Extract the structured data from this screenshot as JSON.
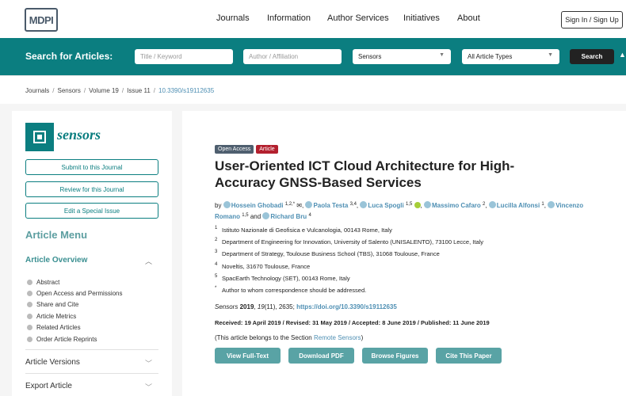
{
  "brand": {
    "logo_text": "MDPI"
  },
  "topnav": {
    "items": [
      "Journals",
      "Information",
      "Author Services",
      "Initiatives",
      "About"
    ],
    "signin": "Sign In / Sign Up"
  },
  "search": {
    "title": "Search for Articles:",
    "keyword_placeholder": "Title / Keyword",
    "author_placeholder": "Author / Affiliation",
    "journal_select": "Sensors",
    "type_select": "All Article Types",
    "button": "Search"
  },
  "breadcrumb": [
    "Journals",
    "Sensors",
    "Volume 19",
    "Issue 11",
    "10.3390/s19112635"
  ],
  "sidebar": {
    "journal_name": "sensors",
    "buttons": [
      "Submit to this Journal",
      "Review for this Journal",
      "Edit a Special Issue"
    ],
    "menu_title": "Article Menu",
    "overview_title": "Article Overview",
    "overview_items": [
      "Abstract",
      "Open Access and Permissions",
      "Share and Cite",
      "Article Metrics",
      "Related Articles",
      "Order Article Reprints"
    ],
    "sections": [
      "Article Versions",
      "Export Article"
    ]
  },
  "article": {
    "badges": [
      "Open Access",
      "Article"
    ],
    "title": "User-Oriented ICT Cloud Architecture for High-Accuracy GNSS-Based Services",
    "by": "by",
    "authors": [
      {
        "name": "Hossein Ghobadi",
        "sup": "1,2,*"
      },
      {
        "name": "Paola Testa",
        "sup": "3,4"
      },
      {
        "name": "Luca Spogli",
        "sup": "1,5"
      },
      {
        "name": "Massimo Cafaro",
        "sup": "2"
      },
      {
        "name": "Lucilla Alfonsi",
        "sup": "1"
      },
      {
        "name": "Vincenzo Romano",
        "sup": "1,5"
      },
      {
        "name": "Richard Bru",
        "sup": "4"
      }
    ],
    "and_word": "and",
    "affiliations": [
      {
        "num": "1",
        "text": "Istituto Nazionale di Geofisica e Vulcanologia, 00143 Rome, Italy"
      },
      {
        "num": "2",
        "text": "Department of Engineering for Innovation, University of Salento (UNISALENTO), 73100 Lecce, Italy"
      },
      {
        "num": "3",
        "text": "Department of Strategy, Toulouse Business School (TBS), 31068 Toulouse, France"
      },
      {
        "num": "4",
        "text": "Noveltis, 31670 Toulouse, France"
      },
      {
        "num": "5",
        "text": "SpacEarth Technology (SET), 00143 Rome, Italy"
      },
      {
        "num": "*",
        "text": "Author to whom correspondence should be addressed."
      }
    ],
    "cite_journal": "Sensors",
    "cite_year": "2019",
    "cite_volume": "19",
    "cite_rest": "(11), 2635;",
    "doi_link": "https://doi.org/10.3390/s19112635",
    "dates": "Received: 19 April 2019 / Revised: 31 May 2019 / Accepted: 8 June 2019 / Published: 11 June 2019",
    "belongs_prefix": "(This article belongs to the Section",
    "belongs_section": "Remote Sensors",
    "belongs_suffix": ")",
    "actions": [
      "View Full-Text",
      "Download PDF",
      "Browse Figures",
      "Cite This Paper"
    ]
  },
  "colors": {
    "accent": "#0b7e80",
    "link": "#4e8fb3",
    "article_badge": "#b3202e",
    "open_access_badge": "#4f5f6f",
    "action_button": "#59a3a5"
  }
}
